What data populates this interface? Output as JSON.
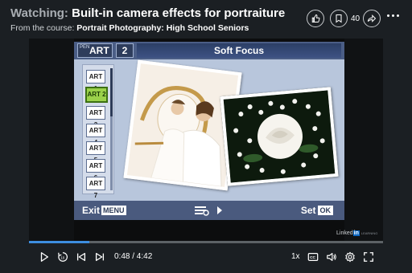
{
  "header": {
    "watching_prefix": "Watching:",
    "title": "Built-in camera effects for portraiture",
    "course_prefix": "From the course:",
    "course_name": "Portrait Photography: High School Seniors",
    "save_count": "40"
  },
  "video": {
    "camera_screen": {
      "pen_label": "PEN",
      "art_label": "ART",
      "art_number": "2",
      "mode_title": "Soft Focus",
      "art_items": [
        {
          "label": "ART 1",
          "active": false
        },
        {
          "label": "ART 2",
          "active": true
        },
        {
          "label": "ART 3",
          "active": false
        },
        {
          "label": "ART 4",
          "active": false
        },
        {
          "label": "ART 5",
          "active": false
        },
        {
          "label": "ART 6",
          "active": false
        },
        {
          "label": "ART 7",
          "active": false
        }
      ],
      "exit_label": "Exit",
      "menu_label": "MENU",
      "set_label": "Set",
      "ok_label": "OK"
    },
    "watermark": {
      "linked": "Linked",
      "in": "in",
      "learning": "LEARNING"
    }
  },
  "player": {
    "progress_fraction": 0.17,
    "current_time": "0:48",
    "duration": "4:42",
    "time_display": "0:48 / 4:42",
    "speed": "1x",
    "accent_color": "#3d8ee0",
    "icons": [
      "play-icon",
      "replay-10-icon",
      "skip-previous-icon",
      "skip-next-icon",
      "captions-icon",
      "volume-icon",
      "settings-icon",
      "fullscreen-icon"
    ]
  }
}
